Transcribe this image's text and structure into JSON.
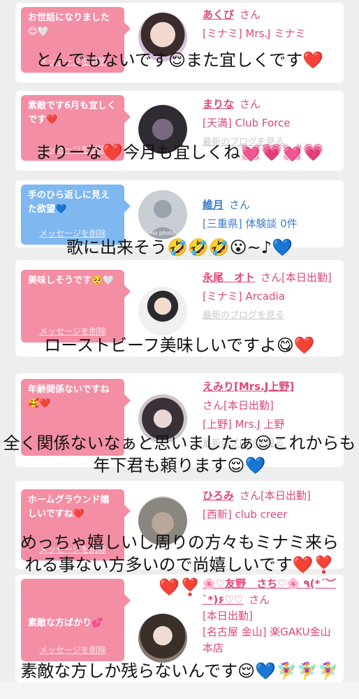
{
  "colors": {
    "accent_pink": "#f38ea5",
    "accent_blue": "#7fb7f0",
    "name_pink": "#e0467a",
    "name_blue": "#3a7bc8"
  },
  "cards": [
    {
      "message": "お世話になりました😊🤍",
      "delete_label": "メッセージを削除",
      "name": "あくび",
      "honorific": "さん",
      "area_shop": "[ミナミ] Mrs.J ミナミ",
      "overlay": "とんでもないです😌また宜しくです❤️"
    },
    {
      "message": "素敵です6月も宜しくです❤️",
      "delete_label": "メッセージを削除",
      "name": "まりな",
      "honorific": "さん",
      "area_shop": "[天満] Club Force",
      "blog": "最新のブログを見る",
      "overlay": "まりーな❤️今月も宜しくね💓💗💓💗"
    },
    {
      "message": "手のひら返しに見えた欲望💙",
      "delete_label": "メッセージを削除",
      "name": "維月",
      "honorific": "さん",
      "area_shop": "[三重県] 体験談 0件",
      "avatar_text": "no photo",
      "overlay": "歌に出来そう🤣🤣🤣😮~♪💙"
    },
    {
      "message": "美味しそうです🥺🤍",
      "delete_label": "メッセージを削除",
      "name": "永尾　オト",
      "honorific": "さん[本日出勤]",
      "area_shop": "[ミナミ] Arcadia",
      "blog": "最新のブログを見る",
      "overlay": "ローストビーフ美味しいですよ😋❤️"
    },
    {
      "message": "年齢関係ないですね🥰❤️",
      "name": "えみり[Mrs.J上野]",
      "honorific": "さん[本日出勤]",
      "area_shop": "[上野] Mrs.J 上野",
      "blog": "最新のブログを見る",
      "overlay": "全く関係ないなぁと思いましたぁ😌これからも年下君も頼ります😌💙"
    },
    {
      "message": "ホームグラウンド嬉しいですね❤️",
      "delete_label": "メッセージを削除",
      "name": "ひろみ",
      "honorific": "さん[本日出勤]",
      "area_shop": "[西新] club creer",
      "overlay": "めっちゃ嬉しいし周りの方々もミナミ来られる事ない方多いので尚嬉しいです❤️❣️❤️❣️"
    },
    {
      "message": "素敵な方ばかり💕",
      "delete_label": "メッセージを削除",
      "name": "🌸♡友野　さち♡🌸 ٩(*´︶`*)۶♡♡",
      "honorific": "さん",
      "today": "[本日出勤]",
      "area_shop": "[名古屋 金山] 楽GAKU金山本店",
      "overlay": "素敵な方しか残らないんです😌💙🧚‍♀️🧚‍♀️🧚‍♀️"
    }
  ]
}
